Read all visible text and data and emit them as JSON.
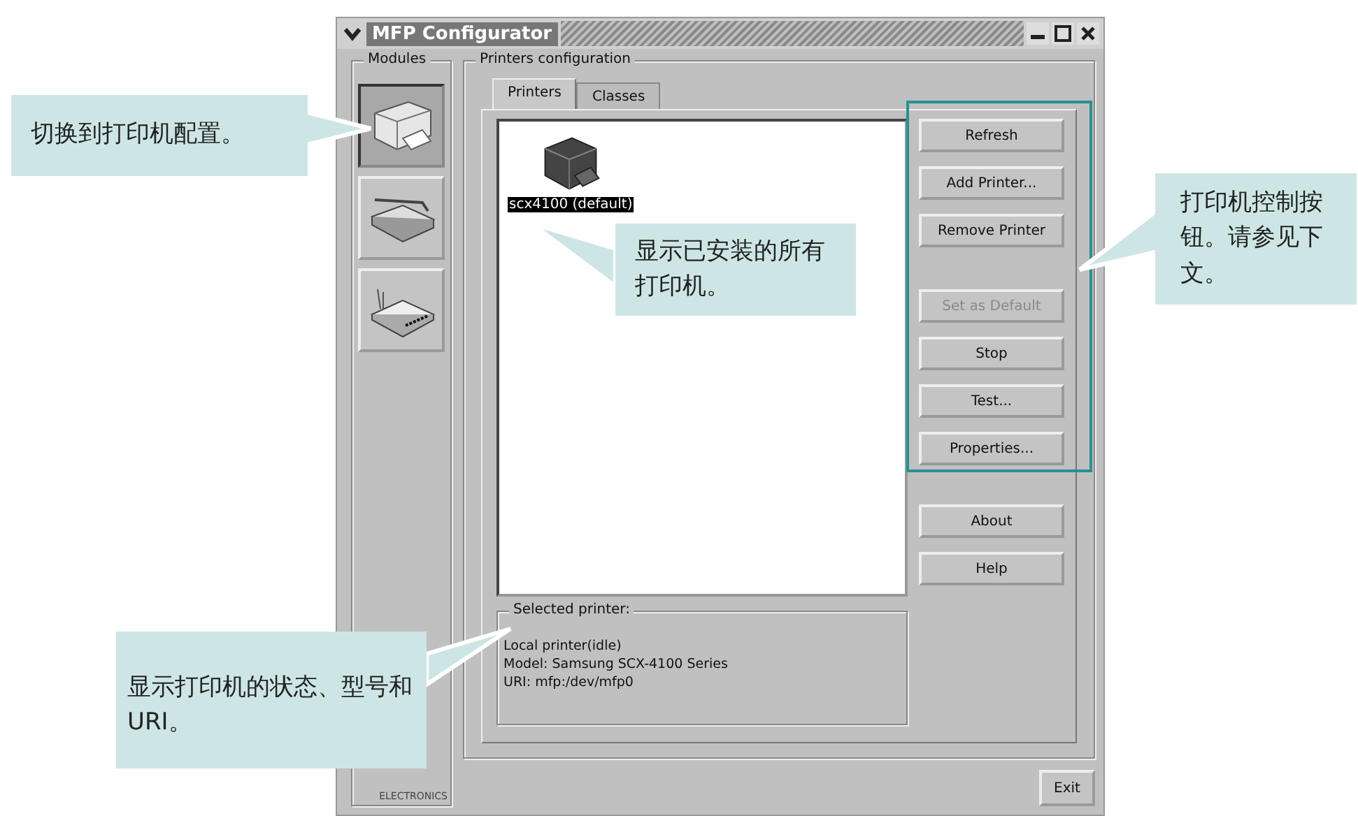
{
  "window": {
    "title": "MFP Configurator"
  },
  "modules": {
    "label": "Modules",
    "items": [
      {
        "kind": "printer",
        "selected": true
      },
      {
        "kind": "scanner",
        "selected": false
      },
      {
        "kind": "port",
        "selected": false
      }
    ],
    "brand": "ELECTRONICS"
  },
  "printers_configuration": {
    "label": "Printers configuration",
    "tabs": [
      {
        "label": "Printers",
        "selected": true
      },
      {
        "label": "Classes",
        "selected": false
      }
    ],
    "printers": [
      {
        "name": "scx4100 (default)",
        "selected": true
      }
    ],
    "buttons": [
      {
        "label": "Refresh",
        "disabled": false
      },
      {
        "label": "Add Printer...",
        "disabled": false
      },
      {
        "label": "Remove Printer",
        "disabled": false
      },
      {
        "label": "Set as Default",
        "disabled": true
      },
      {
        "label": "Stop",
        "disabled": false
      },
      {
        "label": "Test...",
        "disabled": false
      },
      {
        "label": "Properties...",
        "disabled": false
      },
      {
        "label": "About",
        "disabled": false
      },
      {
        "label": "Help",
        "disabled": false
      }
    ],
    "selected_printer": {
      "label": "Selected printer:",
      "lines": [
        "Local printer(idle)",
        "Model: Samsung SCX-4100 Series",
        "URI: mfp:/dev/mfp0"
      ]
    }
  },
  "exit_button": "Exit",
  "callouts": [
    {
      "kind": "modules",
      "text": "切换到打印机配置。"
    },
    {
      "kind": "list",
      "text": "显示已安装的所有打印机。"
    },
    {
      "kind": "buttons",
      "text": "打印机控制按钮。请参见下文。"
    },
    {
      "kind": "info",
      "text": "显示打印机的状态、型号和 URI。"
    }
  ]
}
